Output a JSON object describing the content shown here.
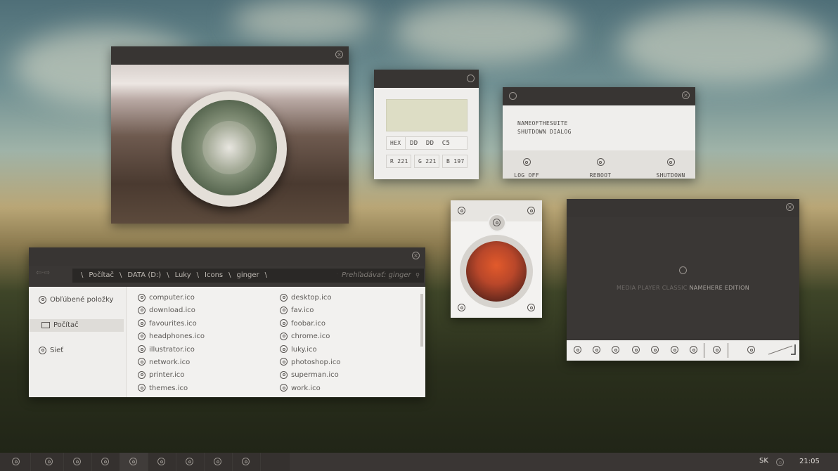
{
  "palette": {
    "titlebar": "#383533",
    "panel": "#efeeec",
    "accent_swatch": "#ddddc5",
    "taskbar": "#3a3634"
  },
  "color_picker": {
    "hex_label": "HEX",
    "hex_value": "DD  DD  C5",
    "r": "R 221",
    "g": "G 221",
    "b": "B 197",
    "swatch": "#DDDDC5"
  },
  "shutdown": {
    "line1": "NAMEOFTHESUITE",
    "line2": "SHUTDOWN DIALOG",
    "logoff": "LOG OFF",
    "reboot": "REBOOT",
    "shutdown": "SHUTDOWN"
  },
  "media": {
    "title_gray": "MEDIA PLAYER CLASSIC",
    "title_bold": "NAMEHERE EDITION"
  },
  "explorer": {
    "breadcrumb": [
      "Počítač",
      "DATA (D:)",
      "Luky",
      "Icons",
      "ginger"
    ],
    "search_placeholder": "Prehľadávať: ginger",
    "sidebar": [
      "Obľúbené položky",
      "Počítač",
      "Sieť"
    ],
    "files_col1": [
      "computer.ico",
      "download.ico",
      "favourites.ico",
      "headphones.ico",
      "illustrator.ico",
      "network.ico",
      "printer.ico",
      "themes.ico"
    ],
    "files_col2": [
      "desktop.ico",
      "fav.ico",
      "foobar.ico",
      "chrome.ico",
      "luky.ico",
      "photoshop.ico",
      "superman.ico",
      "work.ico"
    ]
  },
  "taskbar": {
    "lang": "SK",
    "time": "21:05",
    "icons": [
      "settings-icon",
      "app-icon",
      "app-icon",
      "photoshop-icon",
      "app-icon",
      "app-icon",
      "app-icon",
      "app-icon",
      "app-icon"
    ]
  }
}
